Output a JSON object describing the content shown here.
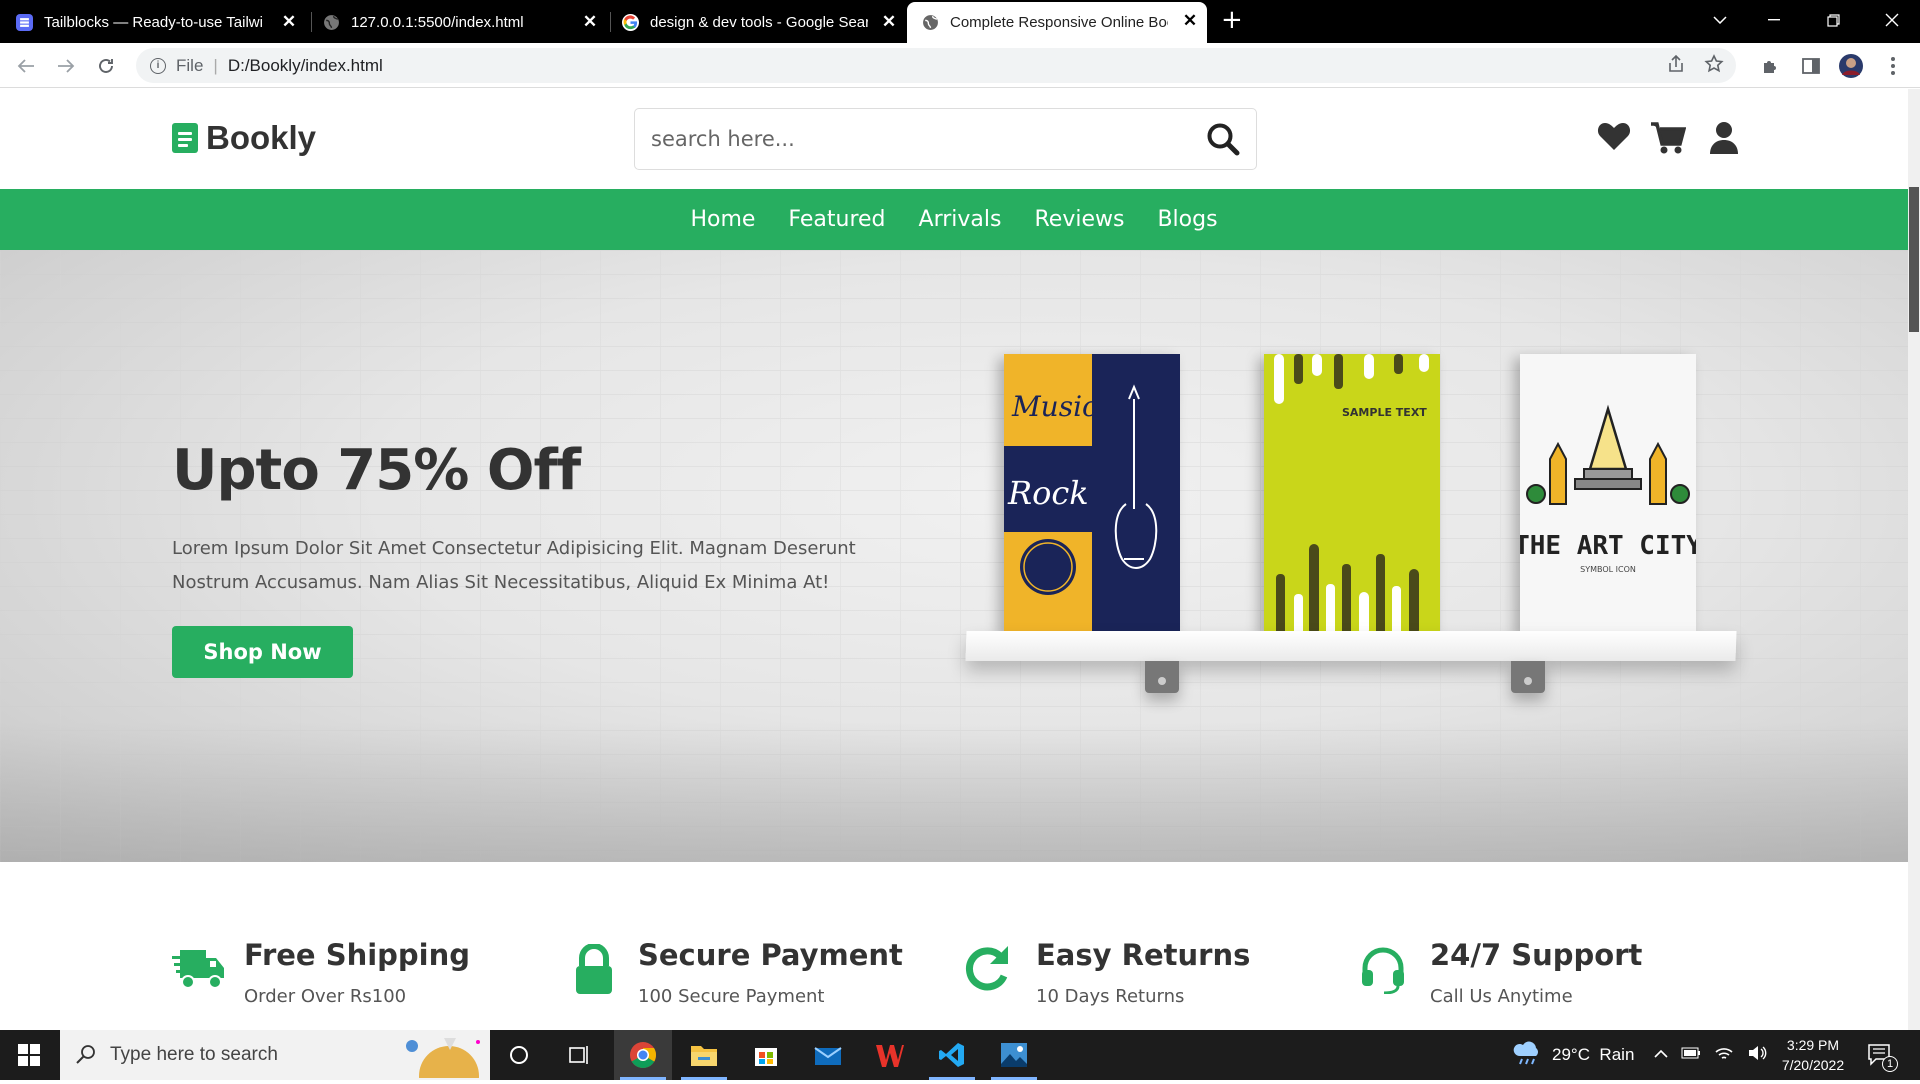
{
  "browser": {
    "tabs": [
      {
        "title": "Tailblocks — Ready-to-use Tailwi",
        "active": false
      },
      {
        "title": "127.0.0.1:5500/index.html",
        "active": false
      },
      {
        "title": "design & dev tools - Google Sear",
        "active": false
      },
      {
        "title": "Complete Responsive Online Boo",
        "active": true
      }
    ],
    "address": {
      "scheme": "File",
      "url": "D:/Bookly/index.html"
    }
  },
  "site": {
    "logo": "Bookly",
    "search_placeholder": "search here...",
    "nav": [
      "Home",
      "Featured",
      "Arrivals",
      "Reviews",
      "Blogs"
    ],
    "hero": {
      "heading": "Upto 75% Off",
      "text": "Lorem Ipsum Dolor Sit Amet Consectetur Adipisicing Elit. Magnam Deserunt Nostrum Accusamus. Nam Alias Sit Necessitatibus, Aliquid Ex Minima At!",
      "button": "Shop Now",
      "books": [
        {
          "cover_text": [
            "Music",
            "Rock"
          ]
        },
        {
          "cover_text": [
            "SAMPLE TEXT"
          ]
        },
        {
          "cover_text": [
            "THE ART CITY",
            "SYMBOL ICON"
          ]
        }
      ]
    },
    "features": [
      {
        "title": "Free Shipping",
        "sub": "Order Over Rs100",
        "icon": "truck-icon"
      },
      {
        "title": "Secure Payment",
        "sub": "100 Secure Payment",
        "icon": "lock-icon"
      },
      {
        "title": "Easy Returns",
        "sub": "10 Days Returns",
        "icon": "redo-icon"
      },
      {
        "title": "24/7 Support",
        "sub": "Call Us Anytime",
        "icon": "headset-icon"
      }
    ],
    "accent": "#27ae60"
  },
  "taskbar": {
    "search_placeholder": "Type here to search",
    "weather": "29°C  Rain",
    "time": "3:29 PM",
    "date": "7/20/2022",
    "notifications": "1"
  }
}
